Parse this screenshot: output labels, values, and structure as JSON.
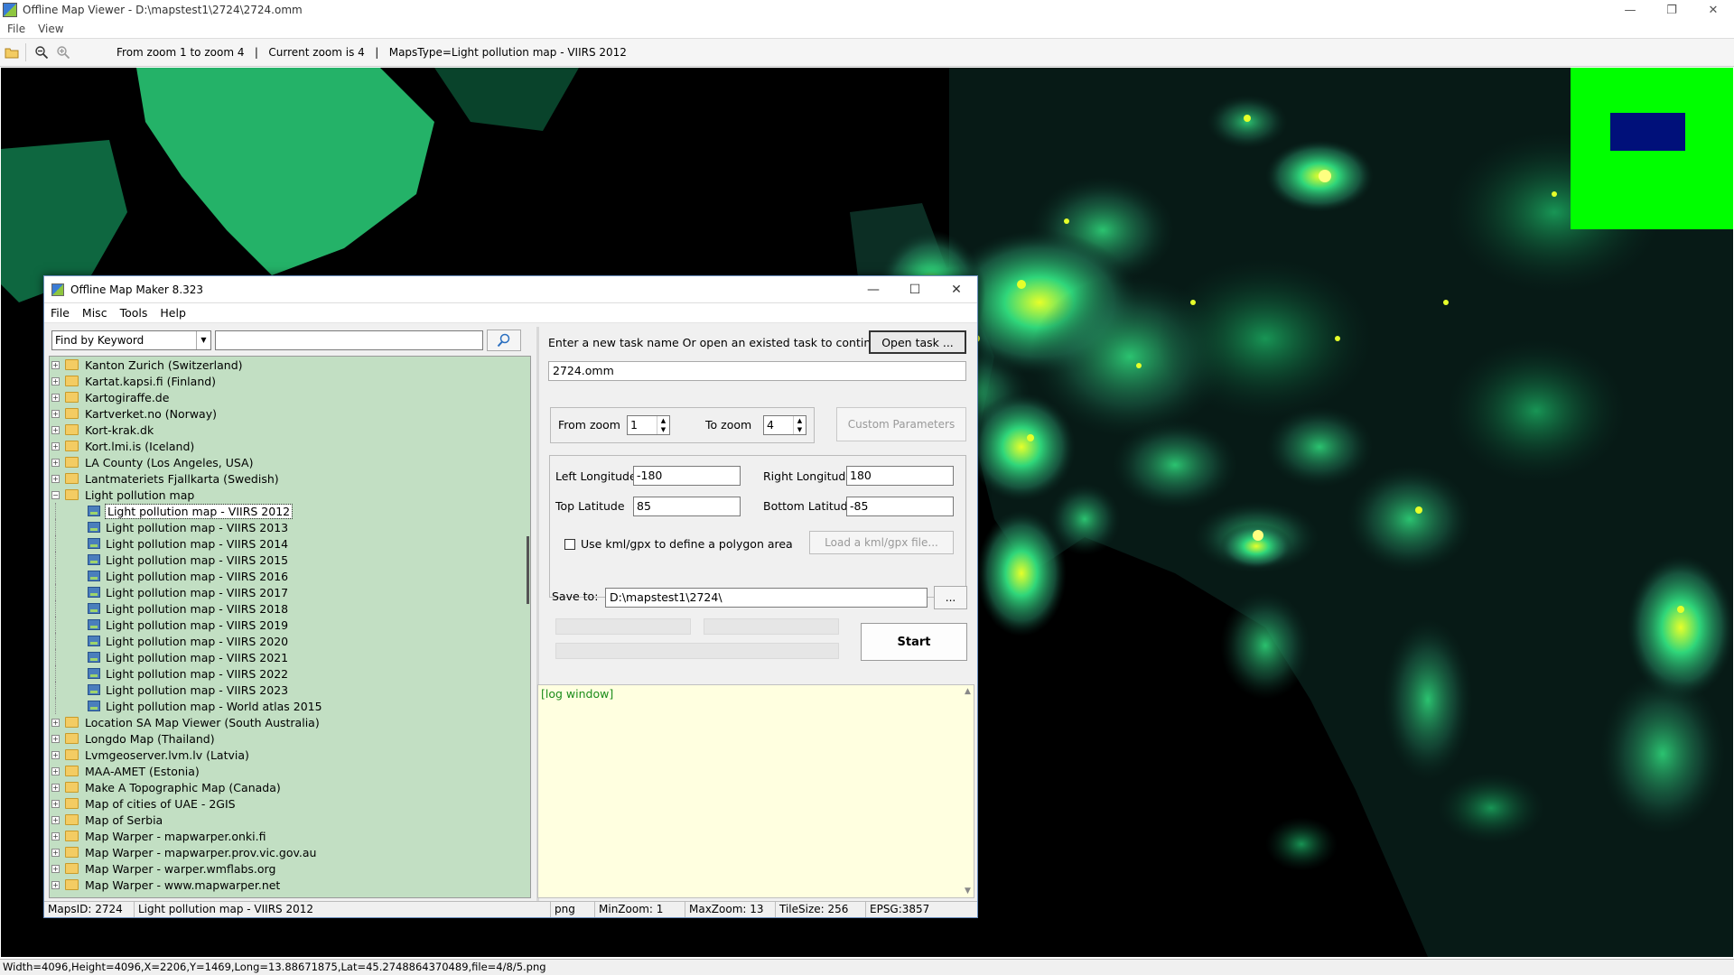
{
  "viewer": {
    "title": "Offline Map Viewer - D:\\mapstest1\\2724\\2724.omm",
    "menu": [
      "File",
      "View"
    ],
    "toolbar_info": "From zoom 1 to zoom 4   |   Current zoom is 4   |   MapsType=Light pollution map - VIIRS 2012",
    "status": "Width=4096,Height=4096,X=2206,Y=1469,Long=13.88671875,Lat=45.2748864370489,file=4/8/5.png",
    "map_colors": {
      "background": "#000000",
      "glow_low": "#1e6b4e",
      "glow_mid": "#2fd67a",
      "glow_high": "#e6ff2a"
    },
    "overview_colors": {
      "background": "#00ff00",
      "viewport": "#00107a"
    }
  },
  "dialog": {
    "title": "Offline Map Maker 8.323",
    "menu": [
      "File",
      "Misc",
      "Tools",
      "Help"
    ],
    "search": {
      "mode": "Find by Keyword",
      "value": ""
    },
    "tree": [
      {
        "label": "Kanton Zurich (Switzerland)",
        "type": "folder",
        "expanded": false
      },
      {
        "label": "Kartat.kapsi.fi (Finland)",
        "type": "folder",
        "expanded": false
      },
      {
        "label": "Kartogiraffe.de",
        "type": "folder",
        "expanded": false
      },
      {
        "label": "Kartverket.no (Norway)",
        "type": "folder",
        "expanded": false
      },
      {
        "label": "Kort-krak.dk",
        "type": "folder",
        "expanded": false
      },
      {
        "label": "Kort.lmi.is (Iceland)",
        "type": "folder",
        "expanded": false
      },
      {
        "label": "LA County (Los Angeles, USA)",
        "type": "folder",
        "expanded": false
      },
      {
        "label": "Lantmateriets Fjallkarta (Swedish)",
        "type": "folder",
        "expanded": false
      },
      {
        "label": "Light pollution map",
        "type": "folder",
        "expanded": true
      },
      {
        "label": "Light pollution map - VIIRS 2012",
        "type": "map",
        "selected": true
      },
      {
        "label": "Light pollution map - VIIRS 2013",
        "type": "map"
      },
      {
        "label": "Light pollution map - VIIRS 2014",
        "type": "map"
      },
      {
        "label": "Light pollution map - VIIRS 2015",
        "type": "map"
      },
      {
        "label": "Light pollution map - VIIRS 2016",
        "type": "map"
      },
      {
        "label": "Light pollution map - VIIRS 2017",
        "type": "map"
      },
      {
        "label": "Light pollution map - VIIRS 2018",
        "type": "map"
      },
      {
        "label": "Light pollution map - VIIRS 2019",
        "type": "map"
      },
      {
        "label": "Light pollution map - VIIRS 2020",
        "type": "map"
      },
      {
        "label": "Light pollution map - VIIRS 2021",
        "type": "map"
      },
      {
        "label": "Light pollution map - VIIRS 2022",
        "type": "map"
      },
      {
        "label": "Light pollution map - VIIRS 2023",
        "type": "map"
      },
      {
        "label": "Light pollution map - World atlas 2015",
        "type": "map"
      },
      {
        "label": "Location SA Map Viewer (South Australia)",
        "type": "folder",
        "expanded": false
      },
      {
        "label": "Longdo Map (Thailand)",
        "type": "folder",
        "expanded": false
      },
      {
        "label": "Lvmgeoserver.lvm.lv (Latvia)",
        "type": "folder",
        "expanded": false
      },
      {
        "label": "MAA-AMET (Estonia)",
        "type": "folder",
        "expanded": false
      },
      {
        "label": "Make A Topographic Map (Canada)",
        "type": "folder",
        "expanded": false
      },
      {
        "label": "Map of cities of UAE - 2GIS",
        "type": "folder",
        "expanded": false
      },
      {
        "label": "Map of Serbia",
        "type": "folder",
        "expanded": false
      },
      {
        "label": "Map Warper - mapwarper.onki.fi",
        "type": "folder",
        "expanded": false
      },
      {
        "label": "Map Warper - mapwarper.prov.vic.gov.au",
        "type": "folder",
        "expanded": false
      },
      {
        "label": "Map Warper - warper.wmflabs.org",
        "type": "folder",
        "expanded": false
      },
      {
        "label": "Map Warper - www.mapwarper.net",
        "type": "folder",
        "expanded": false
      }
    ],
    "task_prompt": "Enter a new task name Or open an existed task to continue:",
    "open_task_label": "Open task ...",
    "task_name": "2724.omm",
    "from_zoom_label": "From zoom",
    "from_zoom": "1",
    "to_zoom_label": "To zoom",
    "to_zoom": "4",
    "custom_params_label": "Custom Parameters",
    "left_lon_label": "Left Longitude",
    "left_lon": "-180",
    "right_lon_label": "Right Longitude",
    "right_lon": "180",
    "top_lat_label": "Top Latitude",
    "top_lat": "85",
    "bottom_lat_label": "Bottom Latitude",
    "bottom_lat": "-85",
    "kml_label": "Use kml/gpx to define a polygon area",
    "load_kml_label": "Load a kml/gpx file...",
    "save_label": "Save to:",
    "save_path": "D:\\mapstest1\\2724\\",
    "browse_label": "...",
    "start_label": "Start",
    "log_text": "[log window]",
    "status": {
      "maps_id": "MapsID: 2724",
      "map_name": "Light pollution map - VIIRS 2012",
      "format": "png",
      "min_zoom": "MinZoom: 1",
      "max_zoom": "MaxZoom: 13",
      "tile_size": "TileSize: 256",
      "epsg": "EPSG:3857"
    }
  }
}
